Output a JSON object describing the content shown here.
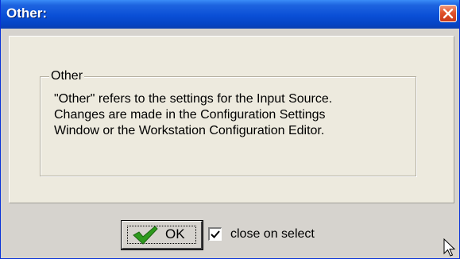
{
  "dialog": {
    "title": "Other:",
    "group": {
      "legend": "Other",
      "lines": [
        "\"Other\" refers to the settings for the Input Source.",
        "Changes are made in the Configuration Settings",
        "Window or the Workstation Configuration Editor."
      ]
    },
    "ok_label": "OK",
    "close_on_select": {
      "label": "close on select",
      "checked": true
    }
  },
  "colors": {
    "titlebar": "#0a4fd6",
    "dialog_bg": "#d6d3ce",
    "panel_bg": "#edeade",
    "close_button": "#e0522c",
    "ok_check": "#2e9a1e"
  },
  "icons": {
    "close": "close-icon",
    "ok": "checkmark-icon",
    "cursor": "mouse-pointer-icon"
  }
}
